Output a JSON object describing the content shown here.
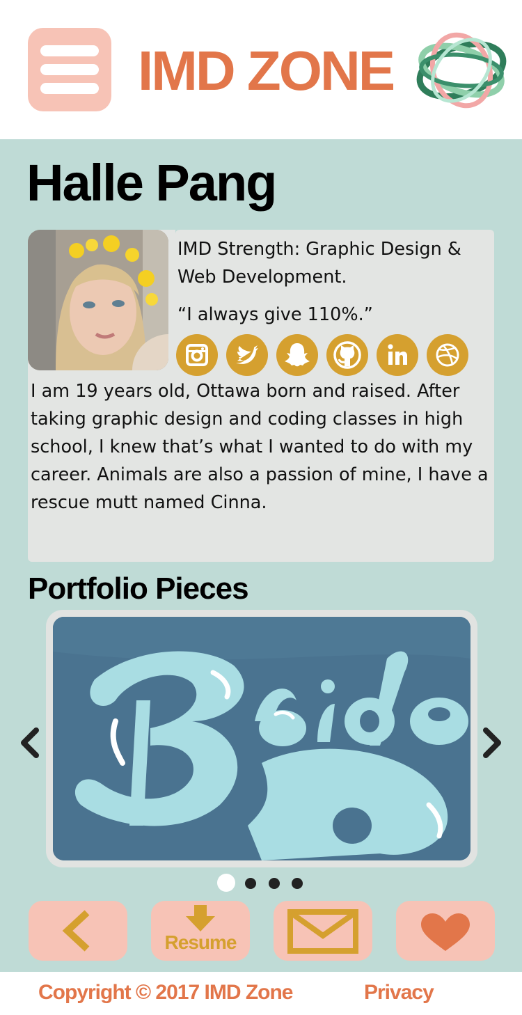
{
  "header": {
    "brand": "IMD ZONE",
    "menu_icon": "hamburger-menu-icon",
    "logo_icon": "rings-logo-icon"
  },
  "profile": {
    "name": "Halle Pang",
    "photo_alt": "profile-photo",
    "strength": "IMD Strength: Graphic Design & Web Development.",
    "quote": "“I always give 110%.”",
    "about": "I am 19 years old, Ottawa born and raised. After taking graphic design and coding classes in high school, I knew that’s what I wanted to do with my career. Animals are also a passion of mine, I have a rescue mutt named Cinna.",
    "socials": [
      "instagram-icon",
      "twitter-icon",
      "snapchat-icon",
      "github-icon",
      "linkedin-icon",
      "dribbble-icon"
    ]
  },
  "portfolio": {
    "title": "Portfolio Pieces",
    "slide_count": 4,
    "active_slide": 1
  },
  "actions": {
    "resume_label": "Resume",
    "icons": [
      "back-chevron-icon",
      "download-icon",
      "mail-icon",
      "heart-icon"
    ]
  },
  "footer": {
    "copyright": "Copyright © 2017 IMD Zone",
    "privacy": "Privacy"
  },
  "colors": {
    "accent_orange": "#e2764a",
    "accent_gold": "#d5a02f",
    "pink": "#f7c3b6",
    "mint_background": "#bfdbd6",
    "card_grey": "#e3e5e3"
  }
}
